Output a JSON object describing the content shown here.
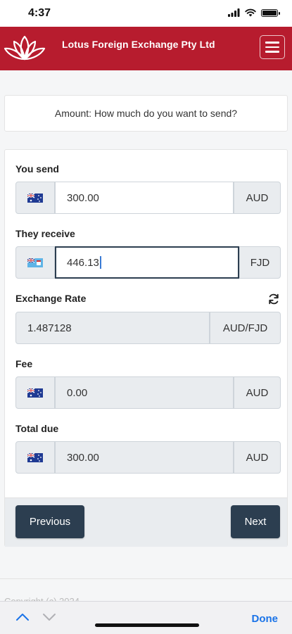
{
  "status_bar": {
    "time": "4:37"
  },
  "header": {
    "brand": "Lotus Foreign Exchange Pty Ltd",
    "brand_color": "#b71c2e"
  },
  "question": "Amount: How much do you want to send?",
  "fields": {
    "you_send": {
      "label": "You send",
      "value": "300.00",
      "currency": "AUD",
      "flag": "australia-flag-icon"
    },
    "they_receive": {
      "label": "They receive",
      "value": "446.13",
      "currency": "FJD",
      "flag": "fiji-flag-icon"
    },
    "exchange_rate": {
      "label": "Exchange Rate",
      "value": "1.487128",
      "pair": "AUD/FJD"
    },
    "fee": {
      "label": "Fee",
      "value": "0.00",
      "currency": "AUD",
      "flag": "australia-flag-icon"
    },
    "total_due": {
      "label": "Total due",
      "value": "300.00",
      "currency": "AUD",
      "flag": "australia-flag-icon"
    }
  },
  "buttons": {
    "previous": "Previous",
    "next": "Next",
    "button_color": "#2c3e50"
  },
  "footer": {
    "copyright": "Copyright (c) 2024"
  },
  "keyboard_bar": {
    "done": "Done"
  }
}
